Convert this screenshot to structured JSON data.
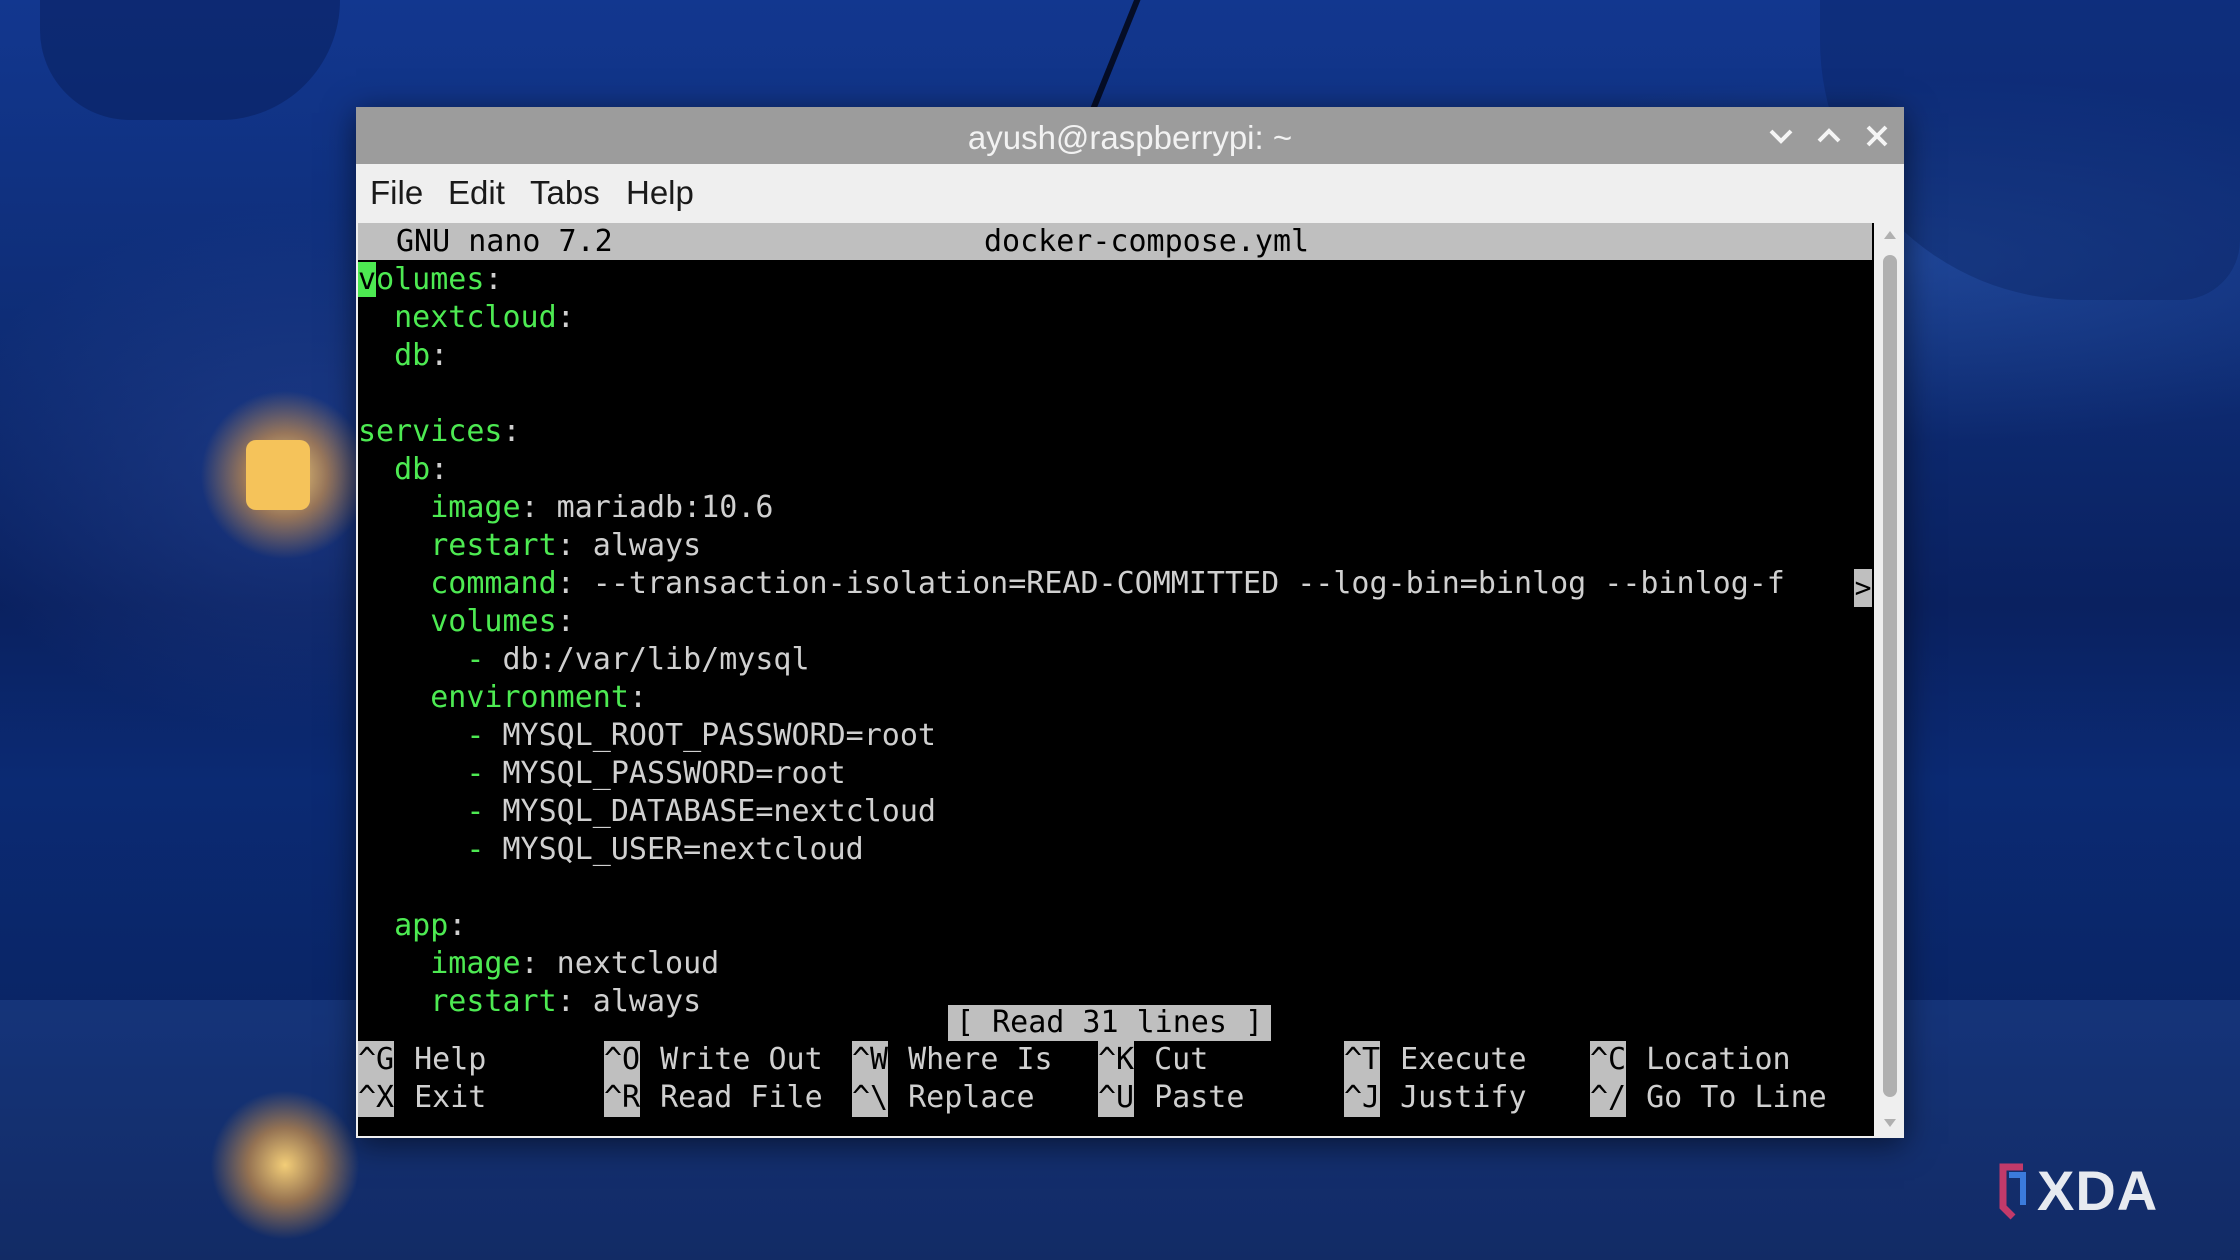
{
  "window": {
    "title": "ayush@raspberrypi: ~"
  },
  "menu": [
    "File",
    "Edit",
    "Tabs",
    "Help"
  ],
  "nano": {
    "version": "GNU nano 7.2",
    "filename": "docker-compose.yml",
    "status": "[ Read 31 lines ]",
    "overflow_indicator": ">",
    "cursor_char": "v"
  },
  "lines": [
    {
      "key": "olumes",
      "sep": ":",
      "val": ""
    },
    {
      "key": "  nextcloud",
      "sep": ":",
      "val": ""
    },
    {
      "key": "  db",
      "sep": ":",
      "val": ""
    },
    {
      "key": "",
      "sep": "",
      "val": ""
    },
    {
      "key": "services",
      "sep": ":",
      "val": ""
    },
    {
      "key": "  db",
      "sep": ":",
      "val": ""
    },
    {
      "key": "    image",
      "sep": ":",
      "val": " mariadb:10.6"
    },
    {
      "key": "    restart",
      "sep": ":",
      "val": " always"
    },
    {
      "key": "    command",
      "sep": ":",
      "val": " --transaction-isolation=READ-COMMITTED --log-bin=binlog --binlog-f"
    },
    {
      "key": "    volumes",
      "sep": ":",
      "val": ""
    },
    {
      "key": "      -",
      "sep": "",
      "val": " db:/var/lib/mysql"
    },
    {
      "key": "    environment",
      "sep": ":",
      "val": ""
    },
    {
      "key": "      -",
      "sep": "",
      "val": " MYSQL_ROOT_PASSWORD=root"
    },
    {
      "key": "      -",
      "sep": "",
      "val": " MYSQL_PASSWORD=root"
    },
    {
      "key": "      -",
      "sep": "",
      "val": " MYSQL_DATABASE=nextcloud"
    },
    {
      "key": "      -",
      "sep": "",
      "val": " MYSQL_USER=nextcloud"
    },
    {
      "key": "",
      "sep": "",
      "val": ""
    },
    {
      "key": "  app",
      "sep": ":",
      "val": ""
    },
    {
      "key": "    image",
      "sep": ":",
      "val": " nextcloud"
    },
    {
      "key": "    restart",
      "sep": ":",
      "val": " always"
    }
  ],
  "shortcuts": [
    {
      "key": "^G",
      "label": "Help"
    },
    {
      "key": "^O",
      "label": "Write Out"
    },
    {
      "key": "^W",
      "label": "Where Is"
    },
    {
      "key": "^K",
      "label": "Cut"
    },
    {
      "key": "^T",
      "label": "Execute"
    },
    {
      "key": "^C",
      "label": "Location"
    },
    {
      "key": "^X",
      "label": "Exit"
    },
    {
      "key": "^R",
      "label": "Read File"
    },
    {
      "key": "^\\",
      "label": "Replace"
    },
    {
      "key": "^U",
      "label": "Paste"
    },
    {
      "key": "^J",
      "label": "Justify"
    },
    {
      "key": "^/",
      "label": "Go To Line"
    }
  ],
  "watermark": "XDA",
  "colors": {
    "syntax_key": "#4dea52",
    "titlebar": "#9c9c9c",
    "shortcut_key_bg": "#bfbfbf"
  },
  "icons": [
    "minimize-chevron-down-icon",
    "maximize-chevron-up-icon",
    "close-x-icon",
    "scroll-up-arrow-icon",
    "scroll-down-arrow-icon",
    "xda-logo-icon"
  ]
}
